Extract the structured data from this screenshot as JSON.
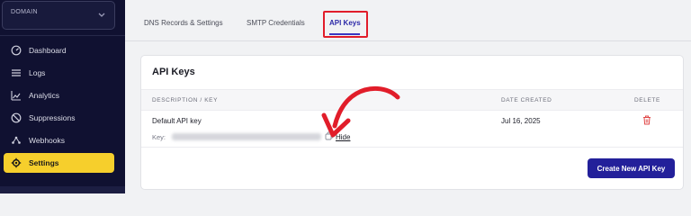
{
  "sidebar": {
    "domain_label": "DOMAIN",
    "items": [
      {
        "label": "Dashboard",
        "icon": "dashboard-icon"
      },
      {
        "label": "Logs",
        "icon": "list-icon"
      },
      {
        "label": "Analytics",
        "icon": "chart-icon"
      },
      {
        "label": "Suppressions",
        "icon": "block-icon"
      },
      {
        "label": "Webhooks",
        "icon": "webhook-icon"
      },
      {
        "label": "Settings",
        "icon": "gear-icon",
        "active": true
      }
    ]
  },
  "tabs": [
    {
      "label": "DNS Records & Settings"
    },
    {
      "label": "SMTP Credentials"
    },
    {
      "label": "API Keys",
      "active": true
    }
  ],
  "card": {
    "title": "API Keys",
    "headers": {
      "description": "DESCRIPTION / KEY",
      "date_created": "DATE CREATED",
      "delete": "DELETE"
    },
    "rows": [
      {
        "description": "Default API key",
        "key_label": "Key:",
        "hide_label": "Hide",
        "date_created": "Jul 16, 2025"
      }
    ],
    "create_button": "Create New API Key"
  },
  "colors": {
    "sidebar_bg": "#101131",
    "active_nav": "#f6cf2c",
    "primary_button": "#23209a",
    "highlight": "#e11d2a",
    "delete": "#e04848"
  }
}
